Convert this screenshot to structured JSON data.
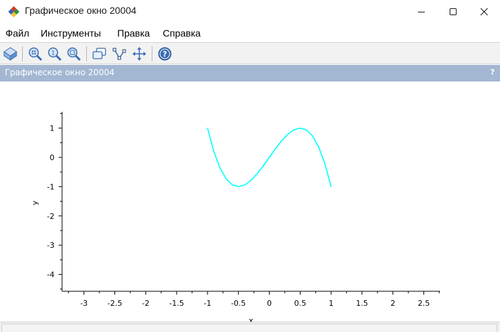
{
  "window": {
    "title": "Графическое окно 20004",
    "controls": [
      "minimize-icon",
      "maximize-icon",
      "close-icon"
    ]
  },
  "menu": {
    "items": [
      "Файл",
      "Инструменты",
      "Правка",
      "Справка"
    ]
  },
  "toolbar": {
    "buttons": [
      "rotate-icon",
      "zoom-in-icon",
      "zoom-original-icon",
      "zoom-out-icon",
      "datatip-icon",
      "edit-curve-icon",
      "pan-icon",
      "help-icon"
    ]
  },
  "panel": {
    "title": "Графическое окно 20004",
    "help": "?"
  },
  "colors": {
    "panel_header": "#a3b7d3",
    "curve": "#00ffff",
    "toolbar_icon": "#3a6db3"
  },
  "chart_data": {
    "type": "line",
    "title": "",
    "xlabel": "x",
    "ylabel": "y",
    "xlim": [
      -3.5,
      2.75
    ],
    "ylim": [
      -4.5,
      1.5
    ],
    "x_ticks": [
      -3,
      -2.5,
      -2,
      -1.5,
      -1,
      -0.5,
      0,
      0.5,
      1,
      1.5,
      2,
      2.5
    ],
    "x_tick_labels": [
      "-3",
      "-2.5",
      "-2",
      "-1.5",
      "-1",
      "-0.5",
      "0",
      "0.5",
      "1",
      "1.5",
      "2",
      "2.5"
    ],
    "y_ticks": [
      1,
      0,
      -1,
      -2,
      -3,
      -4
    ],
    "y_tick_labels": [
      "1",
      "0",
      "-1",
      "-2",
      "-3",
      "-4"
    ],
    "grid": false,
    "series": [
      {
        "color": "#00ffff",
        "x": [
          -1,
          -0.9,
          -0.8,
          -0.7,
          -0.6,
          -0.5,
          -0.4,
          -0.3,
          -0.2,
          -0.1,
          0,
          0.1,
          0.2,
          0.3,
          0.4,
          0.5,
          0.6,
          0.7,
          0.8,
          0.9,
          1
        ],
        "y": [
          1,
          0.216,
          -0.352,
          -0.728,
          -0.936,
          -1,
          -0.944,
          -0.792,
          -0.568,
          -0.296,
          0,
          0.296,
          0.568,
          0.792,
          0.944,
          1,
          0.936,
          0.728,
          0.352,
          -0.216,
          -1
        ]
      }
    ]
  }
}
